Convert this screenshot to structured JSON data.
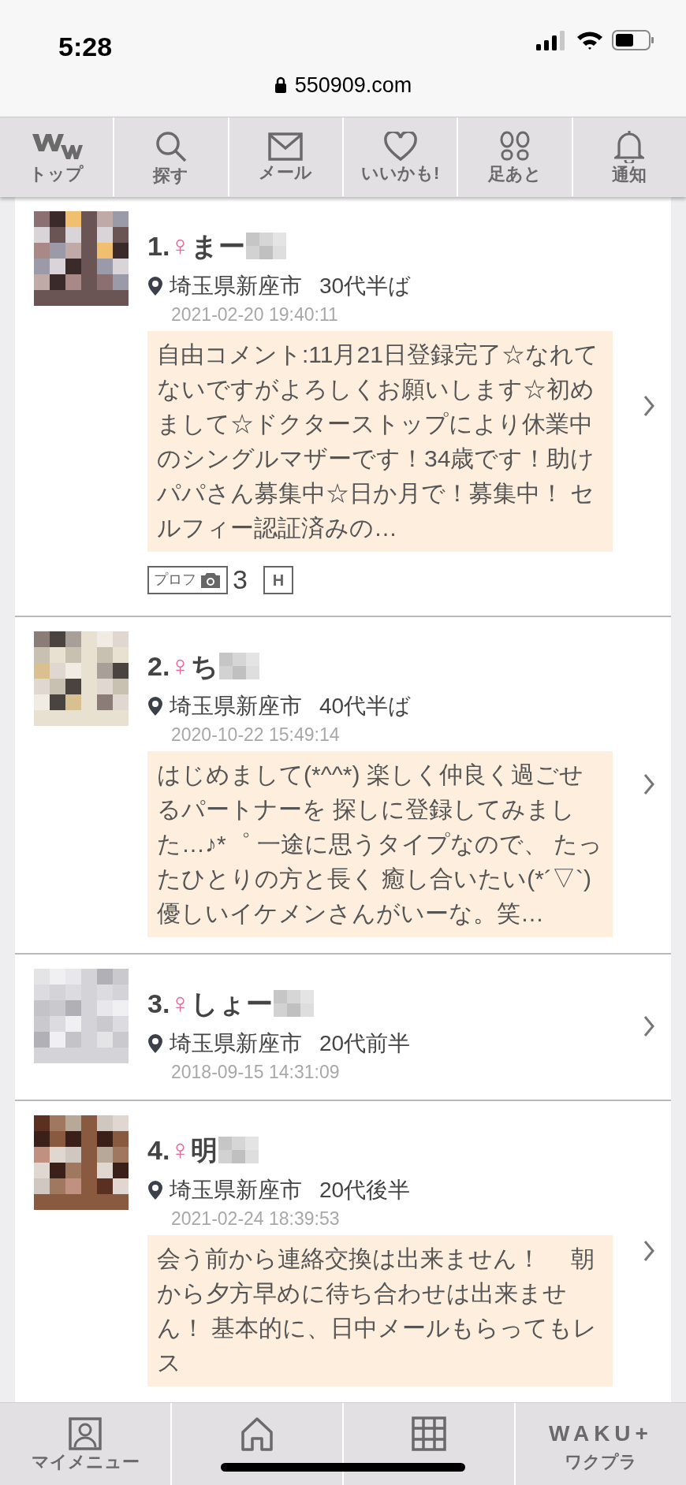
{
  "status_bar": {
    "time": "5:28"
  },
  "address_bar": {
    "url": "550909.com"
  },
  "top_nav": [
    {
      "kind": "logo",
      "label": "トップ"
    },
    {
      "kind": "search",
      "label": "探す"
    },
    {
      "kind": "mail",
      "label": "メール"
    },
    {
      "kind": "heart",
      "label": "いいかも!"
    },
    {
      "kind": "footprints",
      "label": "足あと"
    },
    {
      "kind": "bell",
      "label": "通知"
    }
  ],
  "entries": [
    {
      "rank": "1.",
      "gender": "♀",
      "name": "まー",
      "location": "埼玉県新座市",
      "age": "30代半ば",
      "date": "2021-02-20 19:40:11",
      "comment": "自由コメント:11月21日登録完了☆なれてないですがよろしくお願いします☆初めまして☆ドクターストップにより休業中のシングルマザーです！34歳です！助けパパさん募集中☆日か月で！募集中！ セルフィー認証済みの…",
      "badges": [
        {
          "label": "プロフ"
        },
        {
          "kind": "count",
          "label": "3"
        },
        {
          "kind": "boxed",
          "label": "H"
        }
      ]
    },
    {
      "rank": "2.",
      "gender": "♀",
      "name": "ち",
      "location": "埼玉県新座市",
      "age": "40代半ば",
      "date": "2020-10-22 15:49:14",
      "comment": "はじめまして(*^^*) 楽しく仲良く過ごせるパートナーを 探しに登録してみました…♪*゜ 一途に思うタイプなので、 たったひとりの方と長く 癒し合いたい(*´▽`) 優しいイケメンさんがいーな。笑…"
    },
    {
      "rank": "3.",
      "gender": "♀",
      "name": "しょー",
      "location": "埼玉県新座市",
      "age": "20代前半",
      "date": "2018-09-15 14:31:09"
    },
    {
      "rank": "4.",
      "gender": "♀",
      "name": "明",
      "location": "埼玉県新座市",
      "age": "20代後半",
      "date": "2021-02-24 18:39:53",
      "comment": "会う前から連絡交換は出来ません！　 朝から夕方早めに待ち合わせは出来ません！ 基本的に、日中メールもらってもレス"
    }
  ],
  "bottom_nav": [
    {
      "kind": "person",
      "label": "マイメニュー"
    },
    {
      "kind": "home"
    },
    {
      "kind": "grid"
    },
    {
      "kind": "wakuplus",
      "label": "ワクプラ",
      "logo": "WAKU+"
    }
  ]
}
